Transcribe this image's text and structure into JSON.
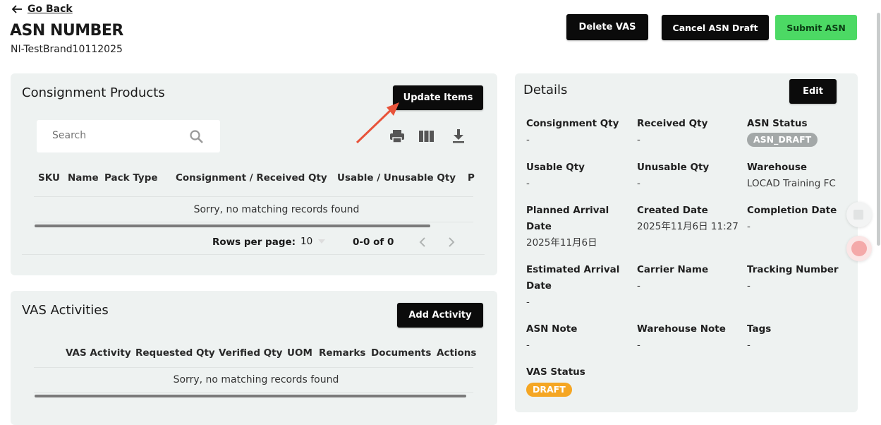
{
  "header": {
    "back_label": "Go Back",
    "title": "ASN NUMBER",
    "asn_id": "NI-TestBrand10112025"
  },
  "actions": {
    "delete_vas": "Delete VAS",
    "cancel_draft": "Cancel ASN Draft",
    "submit": "Submit ASN"
  },
  "consignment": {
    "title": "Consignment Products",
    "update_button": "Update Items",
    "search_placeholder": "Search",
    "columns": [
      "SKU",
      "Name",
      "Pack Type",
      "Consignment / Received Qty",
      "Usable / Unusable Qty",
      "P"
    ],
    "empty_message": "Sorry, no matching records found",
    "rows_per_page_label": "Rows per page:",
    "rows_per_page_value": "10",
    "range": "0-0 of 0"
  },
  "vas": {
    "title": "VAS Activities",
    "add_button": "Add Activity",
    "columns": [
      "VAS Activity",
      "Requested Qty",
      "Verified Qty",
      "UOM",
      "Remarks",
      "Documents",
      "Actions"
    ],
    "empty_message": "Sorry, no matching records found"
  },
  "details": {
    "title": "Details",
    "edit_button": "Edit",
    "consignment_qty_label": "Consignment Qty",
    "consignment_qty": "-",
    "received_qty_label": "Received Qty",
    "received_qty": "-",
    "asn_status_label": "ASN Status",
    "asn_status": "ASN_DRAFT",
    "usable_qty_label": "Usable Qty",
    "usable_qty": "-",
    "unusable_qty_label": "Unusable Qty",
    "unusable_qty": "-",
    "warehouse_label": "Warehouse",
    "warehouse": "LOCAD Training FC",
    "planned_arrival_label_1": "Planned Arrival",
    "planned_arrival_label_2": "Date",
    "planned_arrival": "2025年11月6日",
    "created_date_label": "Created Date",
    "created_date": "2025年11月6日 11:27",
    "completion_date_label": "Completion Date",
    "completion_date": "-",
    "estimated_arrival_label_1": "Estimated Arrival",
    "estimated_arrival_label_2": "Date",
    "estimated_arrival": "-",
    "carrier_name_label": "Carrier Name",
    "carrier_name": "-",
    "tracking_number_label": "Tracking Number",
    "tracking_number": "-",
    "asn_note_label": "ASN Note",
    "asn_note": "-",
    "warehouse_note_label": "Warehouse Note",
    "warehouse_note": "-",
    "tags_label": "Tags",
    "tags": "-",
    "vas_status_label": "VAS Status",
    "vas_status": "DRAFT"
  },
  "colors": {
    "primary": "#0b0b0b",
    "submit_green": "#4cd964",
    "card_bg": "#eef2f1",
    "asn_status_badge": "#a3a8a8",
    "vas_status_badge": "#f5a623",
    "annotation_arrow": "#e8533a"
  },
  "icons": [
    "arrow-left-icon",
    "search-icon",
    "print-icon",
    "columns-icon",
    "download-icon",
    "chevron-down-icon",
    "chevron-left-icon",
    "chevron-right-icon"
  ]
}
